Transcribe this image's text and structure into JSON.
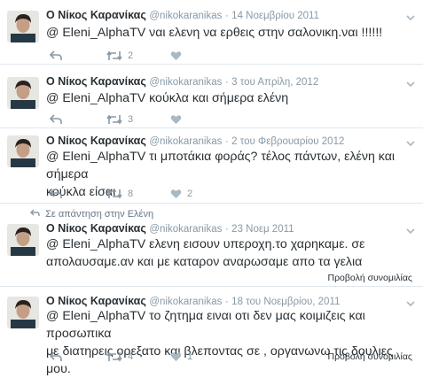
{
  "tweets": [
    {
      "name": "Ο Νίκος Καρανίκας",
      "handle": "@nikokaranikas",
      "dot": "·",
      "date": "14 Νοεμβρίου 2011",
      "text": [
        "@ Eleni_AlphaTV ναι ελενη να ερθεις στην σαλονικη.ναι !!!!!!"
      ],
      "retweets": "2",
      "likes": ""
    },
    {
      "name": "Ο Νίκος Καρανίκας",
      "handle": "@nikokaranikas",
      "dot": "·",
      "date": "3 του Απρίλη, 2012",
      "text": [
        "@ Eleni_AlphaTV κούκλα και σήμερα ελένη"
      ],
      "retweets": "3",
      "likes": ""
    },
    {
      "name": "Ο Νίκος Καρανίκας",
      "handle": "@nikokaranikas",
      "dot": "·",
      "date": "2 του Φεβρουαρίου 2012",
      "text": [
        "@ Eleni_AlphaTV τι μποτάκια φοράς? τέλος πάντων, ελένη και σήμερα",
        "κούκλα είσαι"
      ],
      "retweets": "8",
      "likes": "2"
    },
    {
      "context": "Σε απάντηση στην Ελένη",
      "name": "Ο Νίκος Καρανίκας",
      "handle": "@nikokaranikas",
      "dot": "·",
      "date": "23 Νοεμ 2011",
      "text": [
        "@ Eleni_AlphaTV ελενη εισουν υπεροχη.το χαρηκαμε. σε",
        "απολαυσαμε.αν και με καταρον αναρωσαμε απο τα γελια"
      ],
      "retweets": "",
      "likes": "",
      "conversation": "Προβολή συνομιλίας"
    },
    {
      "name": "Ο Νίκος Καρανίκας",
      "handle": "@nikokaranikas",
      "dot": "·",
      "date": "18 του Νοεμβρίου, 2011",
      "text": [
        "@ Eleni_AlphaTV το ζητημα ειναι οτι δεν μας κοιμιζεις και προσωπικα",
        "με διατηρεις ορεξατο και βλεποντας σε , οργανωνω τις δουλιες μου."
      ],
      "retweets": "4",
      "likes": "1",
      "conversation": "Προβολή συνομιλίας"
    }
  ],
  "colors": {
    "text": "#292f33",
    "muted": "#8899a6",
    "border": "#e1e8ed",
    "background": "#ffffff"
  },
  "icons": [
    "reply-icon",
    "retweet-icon",
    "heart-icon",
    "caret-down-icon",
    "reply-arrow-icon",
    "avatar"
  ]
}
